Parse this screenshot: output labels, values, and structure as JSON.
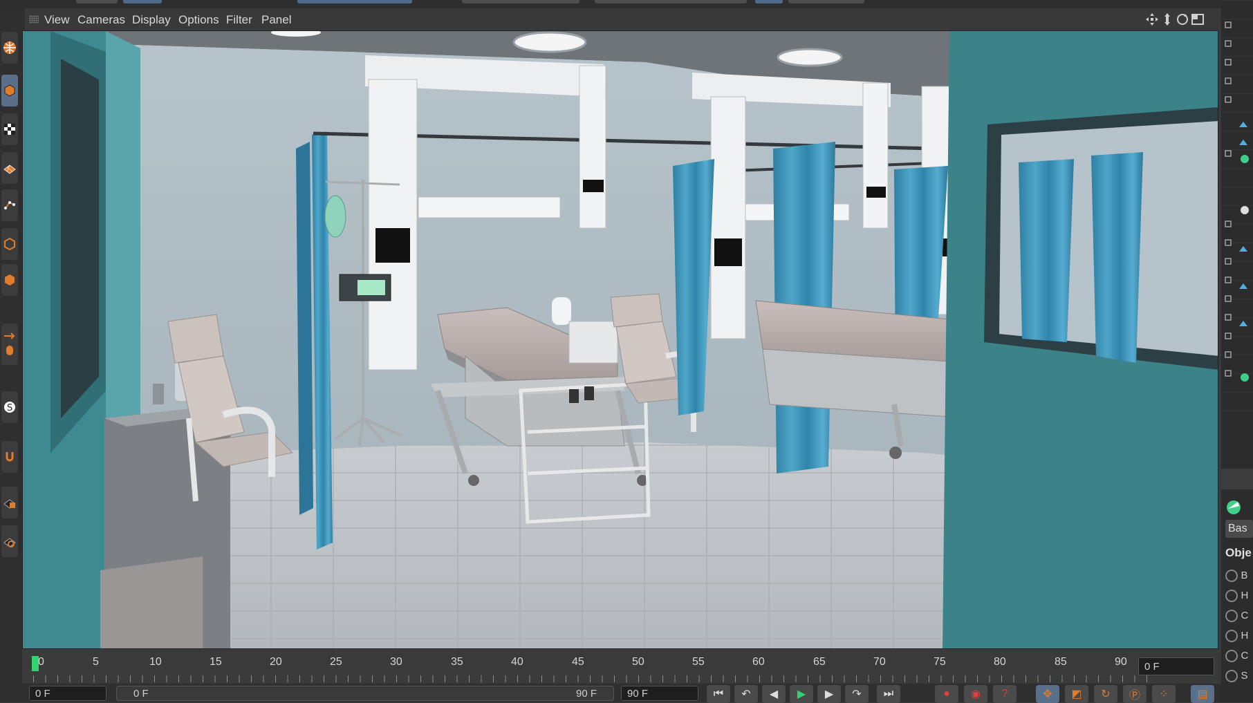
{
  "menu": {
    "items": [
      {
        "label": "View"
      },
      {
        "label": "Cameras"
      },
      {
        "label": "Display"
      },
      {
        "label": "Options"
      },
      {
        "label": "Filter"
      },
      {
        "label": "Panel"
      }
    ]
  },
  "timeline": {
    "ticks": [
      "0",
      "5",
      "10",
      "15",
      "20",
      "25",
      "30",
      "35",
      "40",
      "45",
      "50",
      "55",
      "60",
      "65",
      "70",
      "75",
      "80",
      "85",
      "90"
    ],
    "current_frame_field": "0 F"
  },
  "bottom_bar": {
    "start_frame": "0 F",
    "range_start": "0 F",
    "range_end": "90 F",
    "end_frame": "90 F"
  },
  "right_panel": {
    "tab_label": "Bas",
    "section_label": "Obje",
    "list_letters": [
      "B",
      "H",
      "C",
      "H",
      "C",
      "S"
    ]
  },
  "colors": {
    "accent_blue": "#5a6f8a",
    "playhead_green": "#35d36f",
    "curtain_teal": "#3f93b6",
    "wall": "#aebcc4"
  }
}
